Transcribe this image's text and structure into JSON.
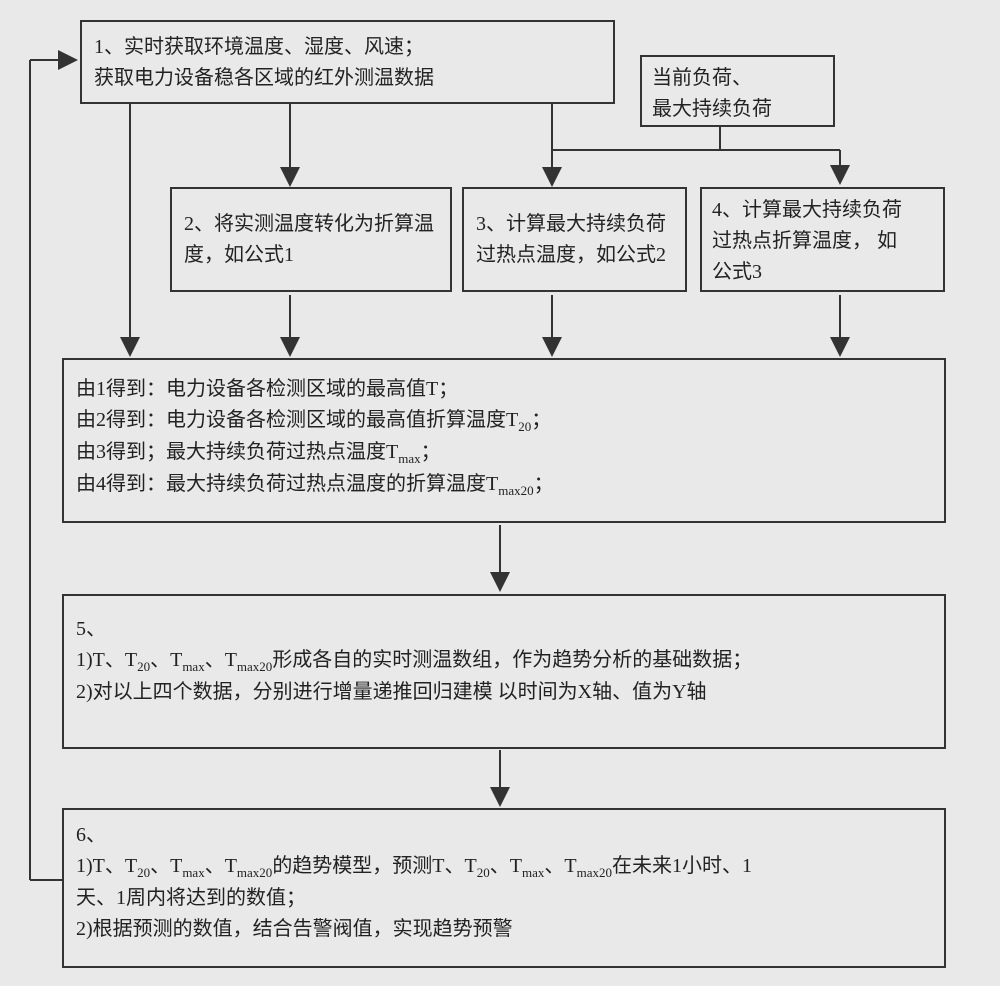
{
  "box1": {
    "line1": "1、实时获取环境温度、湿度、风速；",
    "line2": "获取电力设备稳各区域的红外测温数据"
  },
  "boxLoad": {
    "line1": "当前负荷、",
    "line2": "最大持续负荷"
  },
  "box2": {
    "line1": "2、将实测温度转化为折算温",
    "line2": "度，如公式1"
  },
  "box3": {
    "line1": "3、计算最大持续负荷",
    "line2": "过热点温度，如公式2"
  },
  "box4": {
    "line1": "4、计算最大持续负荷",
    "line2": "过热点折算温度，  如",
    "line3": "公式3"
  },
  "summary": {
    "line1_pre": "由1得到：电力设备各检测区域的最高值T；",
    "line2_a": "由2得到：电力设备各检测区域的最高值折算温度T",
    "line2_sub": "20",
    "line2_b": "；",
    "line3_a": "由3得到；最大持续负荷过热点温度T",
    "line3_sub": "max",
    "line3_b": "；",
    "line4_a": "由4得到：最大持续负荷过热点温度的折算温度T",
    "line4_sub": "max20",
    "line4_b": "；"
  },
  "box5": {
    "title": "5、",
    "l1_a": "1)T、T",
    "l1_s1": "20",
    "l1_b": "、T",
    "l1_s2": "max",
    "l1_c": "、T",
    "l1_s3": "max20",
    "l1_d": "形成各自的实时测温数组，作为趋势分析的基础数据；",
    "l2": "2)对以上四个数据，分别进行增量递推回归建模  以时间为X轴、值为Y轴"
  },
  "box6": {
    "title": "6、",
    "l1_a": "1)T、T",
    "l1_s1": "20",
    "l1_b": "、T",
    "l1_s2": "max",
    "l1_c": "、T",
    "l1_s3": "max20",
    "l1_d": "的趋势模型，预测T、T",
    "l1_s4": "20",
    "l1_e": "、T",
    "l1_s5": "max",
    "l1_f": "、T",
    "l1_s6": "max20",
    "l1_g": "在未来1小时、1",
    "l2": "天、1周内将达到的数值；",
    "l3": "2)根据预测的数值，结合告警阀值，实现趋势预警"
  }
}
